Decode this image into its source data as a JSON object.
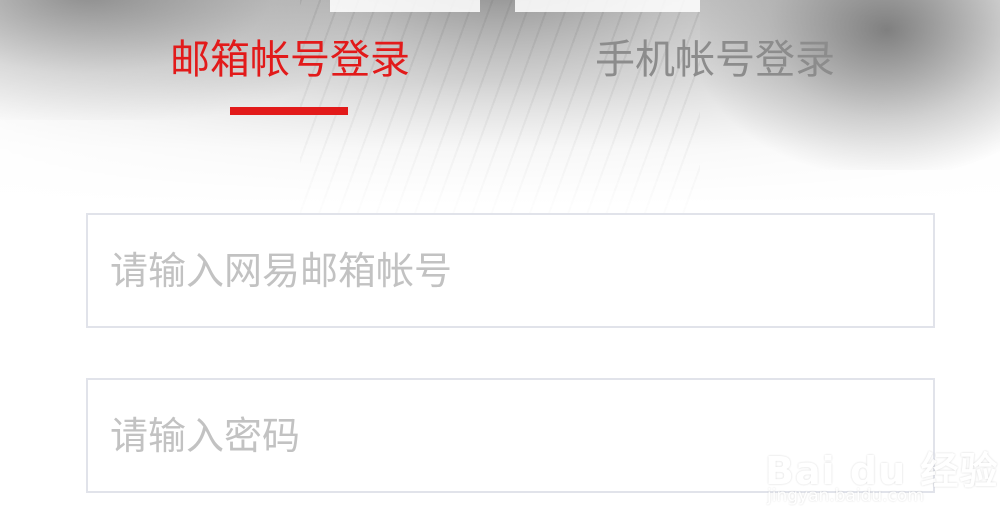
{
  "tabs": {
    "email_login_label": "邮箱帐号登录",
    "phone_login_label": "手机帐号登录",
    "active": "email"
  },
  "form": {
    "account_placeholder": "请输入网易邮箱帐号",
    "account_value": "",
    "password_placeholder": "请输入密码",
    "password_value": ""
  },
  "watermark": {
    "logo_text": "Bai du 经验",
    "url_text": "jingyan.baidu.com"
  },
  "colors": {
    "active_tab": "#e21a1a",
    "inactive_tab": "#8c8c8c",
    "input_border": "#e1e3ea",
    "placeholder": "#c2c2c2"
  },
  "icons": {
    "watermark_paw": "paw-icon"
  }
}
